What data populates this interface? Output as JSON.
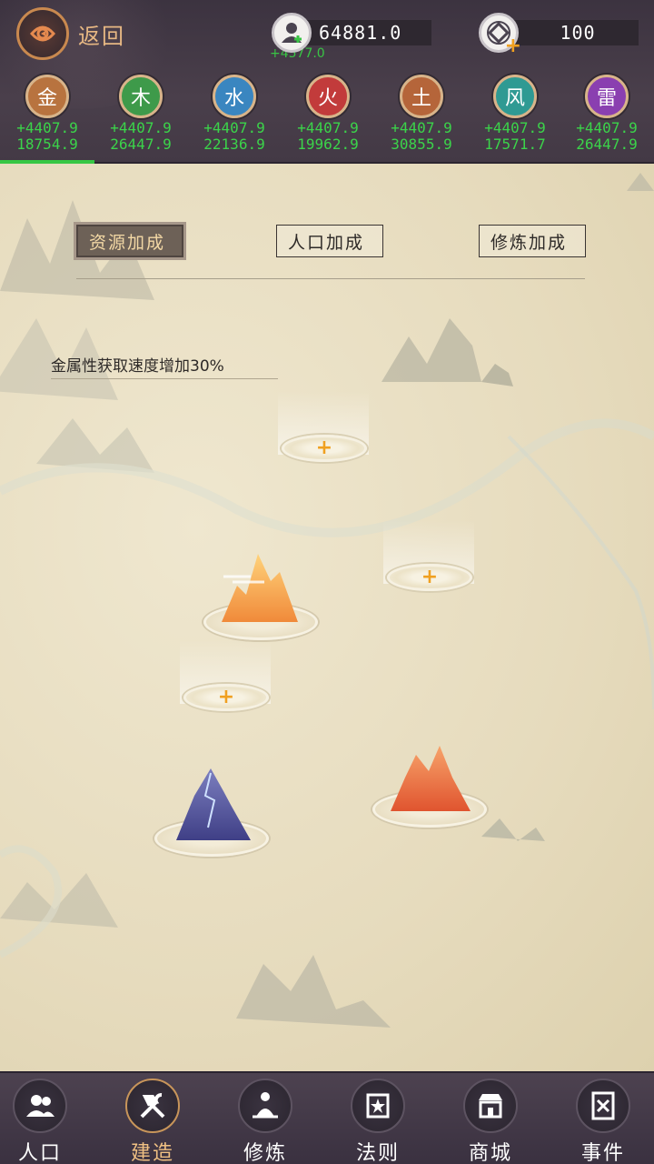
{
  "header": {
    "back_label": "返回",
    "population": {
      "value": "64881.0",
      "delta": "+4577.0"
    },
    "currency": {
      "value": "100"
    }
  },
  "elements": [
    {
      "name": "金",
      "plus": "+4407.9",
      "total": "18754.9",
      "color": "#b8733f"
    },
    {
      "name": "木",
      "plus": "+4407.9",
      "total": "26447.9",
      "color": "#3e9a4a"
    },
    {
      "name": "水",
      "plus": "+4407.9",
      "total": "22136.9",
      "color": "#3a86c0"
    },
    {
      "name": "火",
      "plus": "+4407.9",
      "total": "19962.9",
      "color": "#c23b3b"
    },
    {
      "name": "土",
      "plus": "+4407.9",
      "total": "30855.9",
      "color": "#b5653a"
    },
    {
      "name": "风",
      "plus": "+4407.9",
      "total": "17571.7",
      "color": "#2f9a93"
    },
    {
      "name": "雷",
      "plus": "+4407.9",
      "total": "26447.9",
      "color": "#8a3fb0"
    }
  ],
  "tabs": {
    "resource": "资源加成",
    "population": "人口加成",
    "cultivation": "修炼加成",
    "active": "resource"
  },
  "bonus_text": "金属性获取速度增加30%",
  "bottom_nav": [
    {
      "label": "人口",
      "icon": "people-icon"
    },
    {
      "label": "建造",
      "icon": "hammer-wrench-icon",
      "active": true
    },
    {
      "label": "修炼",
      "icon": "meditation-icon"
    },
    {
      "label": "法则",
      "icon": "scroll-star-icon"
    },
    {
      "label": "商城",
      "icon": "shop-icon"
    },
    {
      "label": "事件",
      "icon": "book-swords-icon"
    }
  ],
  "colors": {
    "accent_green": "#3bd44a",
    "plus_orange": "#f0a020",
    "active_gold": "#f0c083"
  }
}
